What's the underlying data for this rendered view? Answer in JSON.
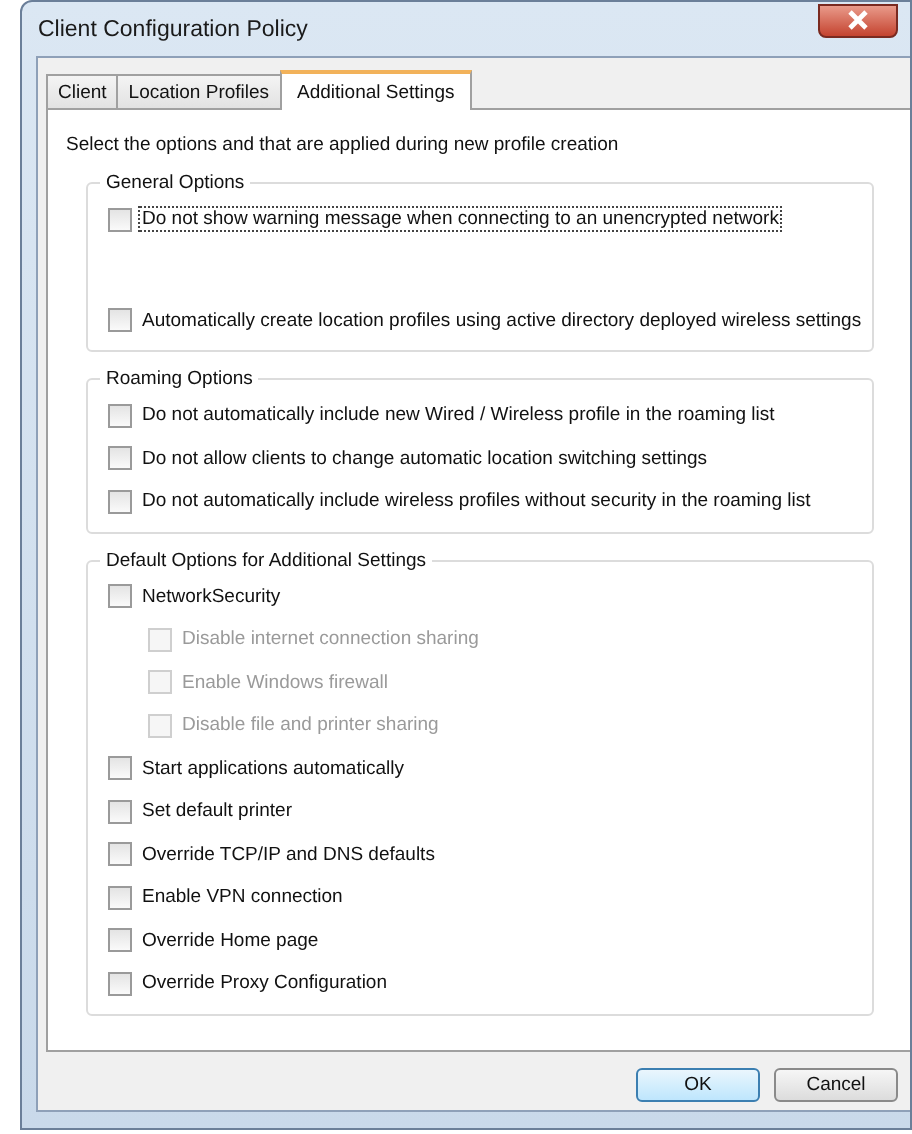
{
  "window": {
    "title": "Client Configuration Policy"
  },
  "tabs": [
    {
      "label": "Client",
      "selected": false
    },
    {
      "label": "Location Profiles",
      "selected": false
    },
    {
      "label": "Additional Settings",
      "selected": true
    }
  ],
  "intro": "Select the options and that are applied during new profile creation",
  "groups": [
    {
      "title": "General Options",
      "options": [
        {
          "label": "Do not show warning message when connecting to an unencrypted network",
          "checked": false,
          "disabled": false,
          "focused": true
        },
        {
          "label": "Automatically create location profiles using active directory deployed wireless settings",
          "checked": false,
          "disabled": false,
          "focused": false
        }
      ]
    },
    {
      "title": "Roaming Options",
      "options": [
        {
          "label": "Do not automatically include new Wired / Wireless profile in the roaming list",
          "checked": false,
          "disabled": false,
          "focused": false
        },
        {
          "label": "Do not allow clients to change automatic location switching settings",
          "checked": false,
          "disabled": false,
          "focused": false
        },
        {
          "label": "Do not automatically include wireless profiles without security in the roaming list",
          "checked": false,
          "disabled": false,
          "focused": false
        }
      ]
    },
    {
      "title": "Default Options for Additional Settings",
      "options": [
        {
          "label": "NetworkSecurity",
          "checked": false,
          "disabled": false,
          "focused": false,
          "children": [
            {
              "label": "Disable internet connection sharing",
              "checked": false,
              "disabled": true,
              "focused": false
            },
            {
              "label": "Enable Windows firewall",
              "checked": false,
              "disabled": true,
              "focused": false
            },
            {
              "label": "Disable file and printer sharing",
              "checked": false,
              "disabled": true,
              "focused": false
            }
          ]
        },
        {
          "label": "Start applications automatically",
          "checked": false,
          "disabled": false,
          "focused": false
        },
        {
          "label": "Set default printer",
          "checked": false,
          "disabled": false,
          "focused": false
        },
        {
          "label": "Override TCP/IP and DNS defaults",
          "checked": false,
          "disabled": false,
          "focused": false
        },
        {
          "label": "Enable VPN connection",
          "checked": false,
          "disabled": false,
          "focused": false
        },
        {
          "label": "Override Home page",
          "checked": false,
          "disabled": false,
          "focused": false
        },
        {
          "label": "Override Proxy Configuration",
          "checked": false,
          "disabled": false,
          "focused": false
        }
      ]
    }
  ],
  "buttons": [
    {
      "label": "OK",
      "default": true
    },
    {
      "label": "Cancel",
      "default": false
    }
  ]
}
